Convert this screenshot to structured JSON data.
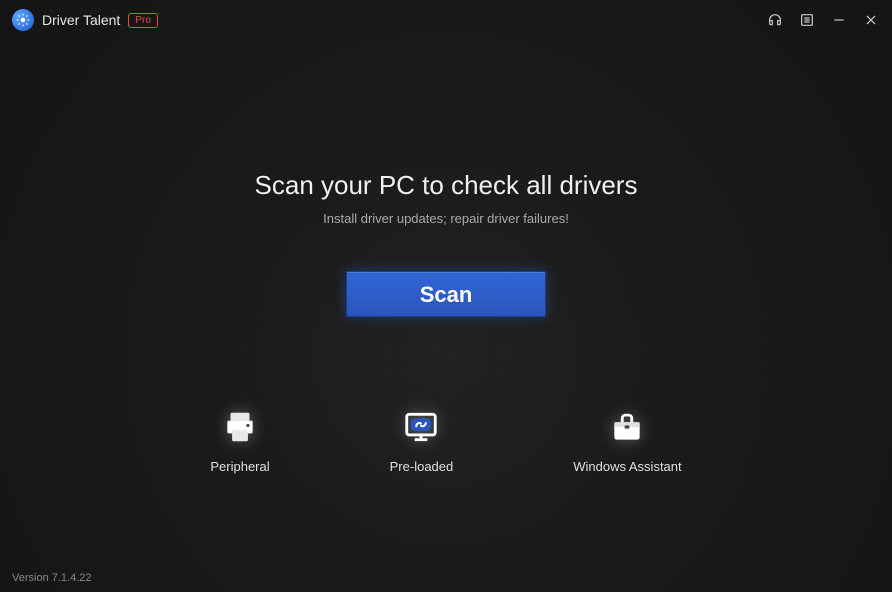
{
  "titlebar": {
    "app_name": "Driver Talent",
    "pro_badge": "Pro"
  },
  "main": {
    "headline": "Scan your PC to check all drivers",
    "subtext": "Install driver updates; repair driver failures!",
    "scan_button": "Scan"
  },
  "tools": [
    {
      "label": "Peripheral",
      "icon": "printer-icon"
    },
    {
      "label": "Pre-loaded",
      "icon": "preloaded-icon"
    },
    {
      "label": "Windows Assistant",
      "icon": "toolbox-icon"
    }
  ],
  "footer": {
    "version": "Version 7.1.4.22"
  }
}
